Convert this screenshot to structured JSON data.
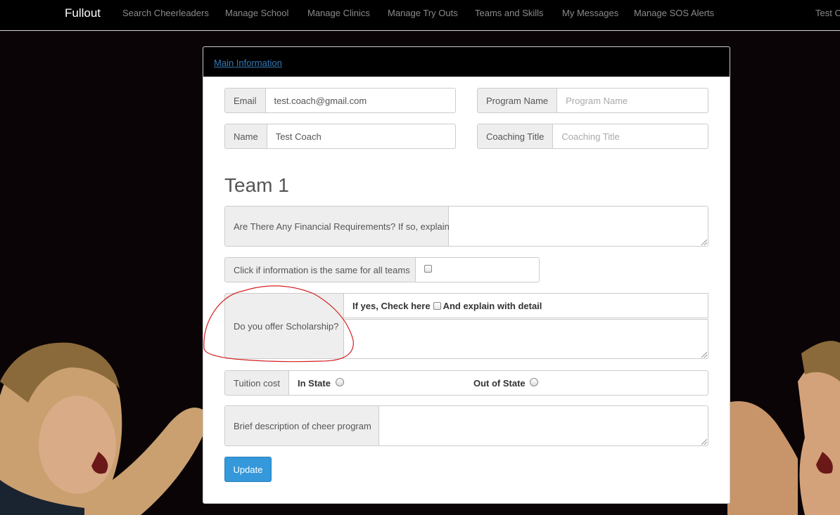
{
  "navbar": {
    "brand": "Fullout",
    "items": [
      "Search Cheerleaders",
      "Manage School",
      "Manage Clinics",
      "Manage Try Outs",
      "Teams and Skills",
      "My Messages",
      "Manage SOS Alerts"
    ],
    "user": "Test Co"
  },
  "panel": {
    "heading": "Main Information"
  },
  "form": {
    "email_label": "Email",
    "email_value": "test.coach@gmail.com",
    "program_label": "Program Name",
    "program_placeholder": "Program Name",
    "name_label": "Name",
    "name_value": "Test Coach",
    "coaching_label": "Coaching Title",
    "coaching_placeholder": "Coaching Title",
    "team_title": "Team 1",
    "financial_label": "Are There Any Financial Requirements? If so, explain",
    "same_info_label": "Click if information is the same for all teams",
    "scholarship_label": "Do you offer Scholarship?",
    "scholarship_check_pre": "If yes, Check here",
    "scholarship_check_post": "And explain with detail",
    "tuition_label": "Tuition cost",
    "in_state_label": "In State",
    "out_state_label": "Out of State",
    "description_label": "Brief description of cheer program",
    "update_button": "Update"
  }
}
